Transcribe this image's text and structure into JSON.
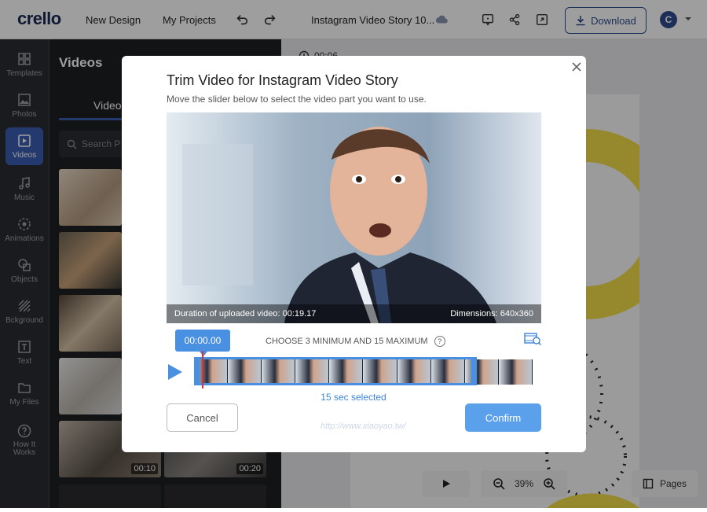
{
  "topbar": {
    "logo": "crello",
    "new_design": "New Design",
    "my_projects": "My Projects",
    "doc_title": "Instagram Video Story 10...",
    "download": "Download",
    "avatar_initial": "C"
  },
  "rail": {
    "items": [
      {
        "label": "Templates",
        "icon": "templates-icon"
      },
      {
        "label": "Photos",
        "icon": "photos-icon"
      },
      {
        "label": "Videos",
        "icon": "videos-icon"
      },
      {
        "label": "Music",
        "icon": "music-icon"
      },
      {
        "label": "Animations",
        "icon": "animations-icon"
      },
      {
        "label": "Objects",
        "icon": "objects-icon"
      },
      {
        "label": "Bckground",
        "icon": "background-icon"
      },
      {
        "label": "Text",
        "icon": "text-icon"
      },
      {
        "label": "My Files",
        "icon": "folder-icon"
      },
      {
        "label": "How It Works",
        "icon": "help-icon"
      }
    ]
  },
  "panel": {
    "title": "Videos",
    "tab": "Video",
    "search_placeholder": "Search P",
    "durations": [
      "00:10",
      "00:20"
    ]
  },
  "canvas": {
    "timer": "00:06",
    "zoom": "39%",
    "pages": "Pages"
  },
  "modal": {
    "title": "Trim Video for Instagram Video Story",
    "subtitle": "Move the slider below to select the video part you want to use.",
    "duration_label": "Duration of uploaded video: 00:19.17",
    "dimensions_label": "Dimensions: 640x360",
    "timecode": "00:00.00",
    "choose_hint": "CHOOSE 3 MINIMUM AND 15 MAXIMUM",
    "help_glyph": "?",
    "selected_text": "15 sec selected",
    "cancel": "Cancel",
    "confirm": "Confirm"
  },
  "watermark": "http://www.xiaoyao.tw/",
  "colors": {
    "brand": "#2f4b8f",
    "accent": "#4a90e2",
    "confirm": "#5ba0ea",
    "playhead": "#e23030",
    "rail_bg": "#2b2d31",
    "panel_bg": "#1e1f23"
  }
}
